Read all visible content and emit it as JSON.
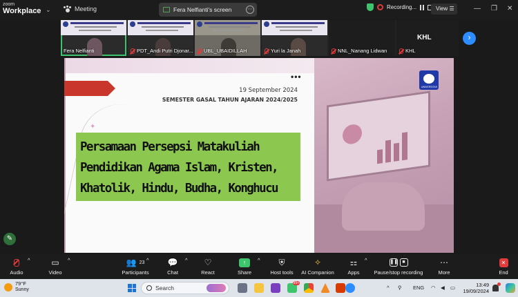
{
  "app": {
    "brand_small": "zoom",
    "brand_large": "Workplace",
    "meeting_label": "Meeting"
  },
  "share": {
    "label": "Fera Nelfianti's screen"
  },
  "recording": {
    "label": "Recording..."
  },
  "view": {
    "label": "View"
  },
  "thumbnails": [
    {
      "name": "Fera Nelfianti",
      "muted": false,
      "active": true
    },
    {
      "name": "PDT_Andi Putri Djonar...",
      "muted": true,
      "active": false
    },
    {
      "name": "UBL_UBAIDILLAH",
      "muted": true,
      "active": false
    },
    {
      "name": "Yuri la Janah",
      "muted": true,
      "active": false
    },
    {
      "name": "NNL_Nanang Lidwan",
      "muted": true,
      "active": false
    },
    {
      "name": "KHL",
      "muted": true,
      "active": false
    }
  ],
  "khl_initials": "KHL",
  "slide": {
    "date": "19 September 2024",
    "semester": "SEMESTER GASAL TAHUN AJARAN 2024/2025",
    "title_lines": [
      "Persamaan Persepsi Matakuliah",
      "Pendidikan Agama Islam, Kristen,",
      "Khatolik, Hindu, Budha, Konghucu"
    ],
    "logo_text": "UNIVERSITAS"
  },
  "toolbar": {
    "audio": "Audio",
    "video": "Video",
    "participants": "Participants",
    "participants_count": "23",
    "chat": "Chat",
    "react": "React",
    "share": "Share",
    "host_tools": "Host tools",
    "ai_companion": "AI Companion",
    "apps": "Apps",
    "pause_stop": "Pause/stop recording",
    "more": "More",
    "end": "End"
  },
  "taskbar": {
    "temp": "79°F",
    "condition": "Sunny",
    "search_placeholder": "Search",
    "lang": "ENG",
    "time": "13:49",
    "date": "19/09/2024",
    "badge_teams": "99+"
  },
  "colors": {
    "accent_green": "#3ec46d",
    "recording_red": "#e23b3b",
    "title_box": "#8cc850",
    "zoom_blue": "#2d8cff"
  }
}
